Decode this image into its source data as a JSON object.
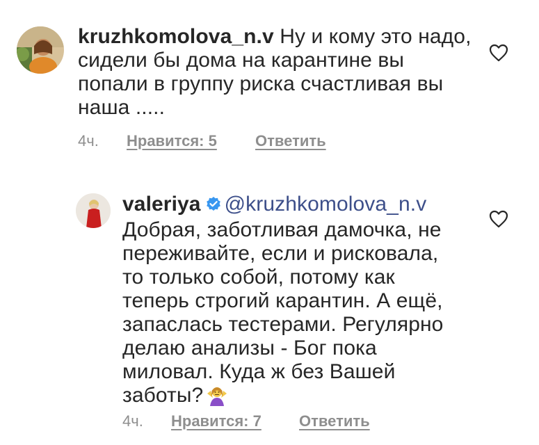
{
  "comments": [
    {
      "username": "kruzhkomolova_n.v",
      "text_lines": [
        " Ну и кому это надо,",
        "сидели бы дома на карантине вы",
        "попали в группу риска счастливая  вы",
        "наша ....."
      ],
      "time": "4ч.",
      "likes_label": "Нравится: 5",
      "reply_label": "Ответить",
      "avatar_icon": "user-avatar-photo",
      "like_icon": "heart-outline-icon"
    },
    {
      "username": "valeriya",
      "verified_icon": "verified-badge-icon",
      "verified_color": "#3897f0",
      "mention": "@kruzhkomolova_n.v",
      "text_lines": [
        "Добрая, заботливая дамочка, не",
        "переживайте, если и рисковала,",
        "то только собой, потому как",
        "теперь строгий карантин. А ещё,",
        "запаслась тестерами. Регулярно",
        "делаю анализы - Бог пока",
        "миловал. Куда ж без Вашей",
        "заботы?"
      ],
      "emoji_icon": "person-shrugging-emoji",
      "time": "4ч.",
      "likes_label": "Нравится: 7",
      "reply_label": "Ответить",
      "avatar_icon": "user-avatar-photo",
      "like_icon": "heart-outline-icon"
    }
  ]
}
